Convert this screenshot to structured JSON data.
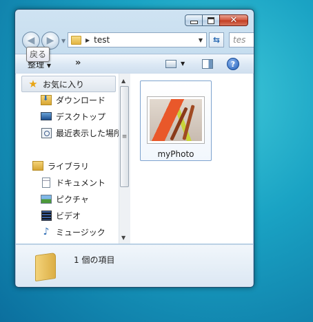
{
  "window": {
    "address": {
      "path": "test"
    },
    "search_placeholder": "tes",
    "tooltip": "戻る",
    "toolbar": {
      "organize": "整理",
      "more": "»"
    }
  },
  "nav": {
    "favorites": "お気に入り",
    "downloads": "ダウンロード",
    "desktop": "デスクトップ",
    "recent": "最近表示した場所",
    "libraries": "ライブラリ",
    "documents": "ドキュメント",
    "pictures": "ピクチャ",
    "videos": "ビデオ",
    "music": "ミュージック"
  },
  "content": {
    "items": [
      {
        "name": "myPhoto",
        "icon": "image-thumbnail-icon"
      }
    ]
  },
  "details": {
    "count_text": "1 個の項目"
  },
  "colors": {
    "close_button": "#c23b21",
    "accent": "#2a6ab3"
  }
}
